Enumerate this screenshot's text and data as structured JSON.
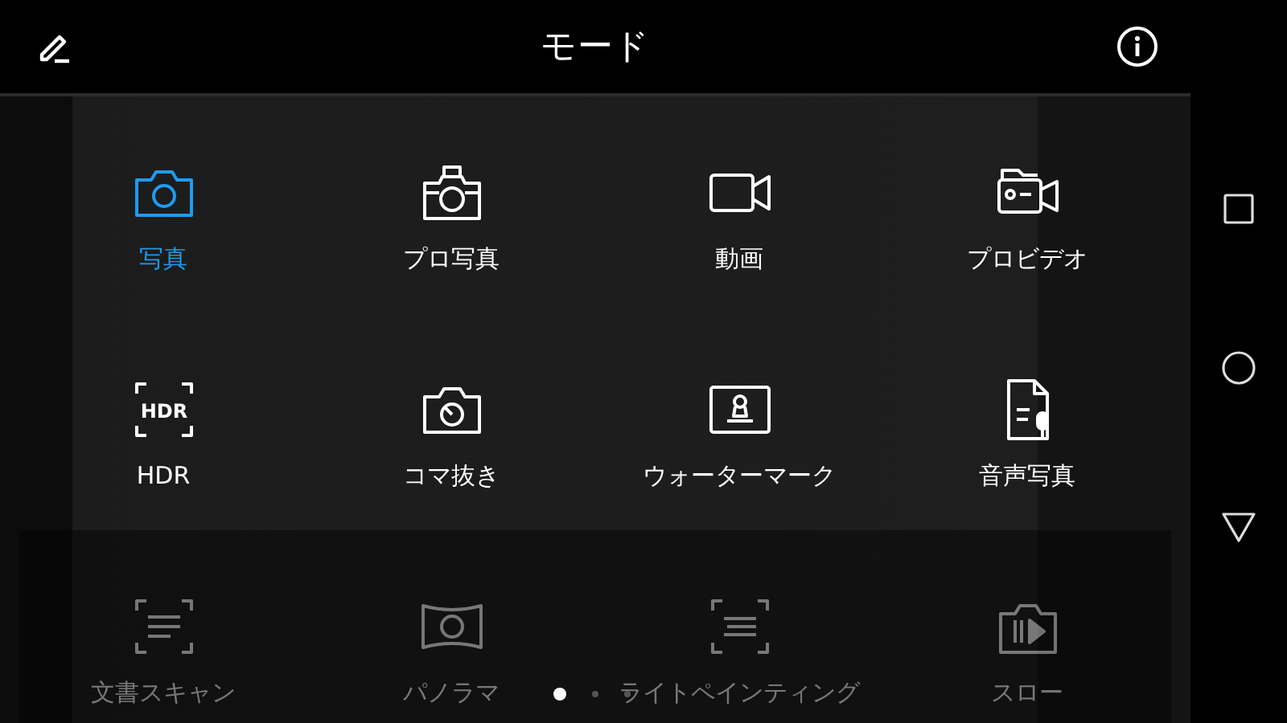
{
  "header": {
    "title": "モード"
  },
  "modes": [
    {
      "label": "写真",
      "kind": "camera",
      "selected": true,
      "dimmed": false
    },
    {
      "label": "プロ写真",
      "kind": "pro-camera",
      "selected": false,
      "dimmed": false
    },
    {
      "label": "動画",
      "kind": "video",
      "selected": false,
      "dimmed": false
    },
    {
      "label": "プロビデオ",
      "kind": "pro-video",
      "selected": false,
      "dimmed": false
    },
    {
      "label": "HDR",
      "kind": "hdr",
      "icon_text": "HDR",
      "selected": false,
      "dimmed": false
    },
    {
      "label": "コマ抜き",
      "kind": "timelapse",
      "selected": false,
      "dimmed": false
    },
    {
      "label": "ウォーターマーク",
      "kind": "watermark",
      "selected": false,
      "dimmed": false
    },
    {
      "label": "音声写真",
      "kind": "audio-note",
      "selected": false,
      "dimmed": false
    },
    {
      "label": "文書スキャン",
      "kind": "scan",
      "selected": false,
      "dimmed": true
    },
    {
      "label": "パノラマ",
      "kind": "panorama",
      "selected": false,
      "dimmed": true
    },
    {
      "label": "ライトペインティング",
      "kind": "light-painting",
      "selected": false,
      "dimmed": true
    },
    {
      "label": "スロー",
      "kind": "slow",
      "selected": false,
      "dimmed": true
    }
  ],
  "pages": [
    {
      "selected": true
    },
    {
      "selected": false
    },
    {
      "selected": false
    }
  ]
}
